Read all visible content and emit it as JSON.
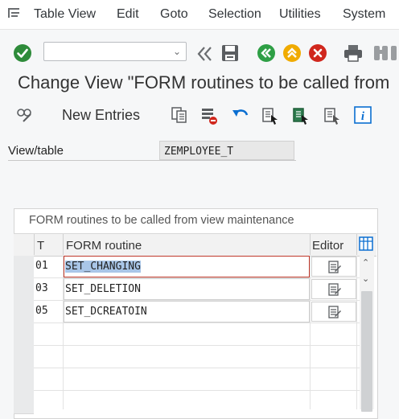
{
  "menu": {
    "items": [
      "Table View",
      "Edit",
      "Goto",
      "Selection",
      "Utilities",
      "System"
    ]
  },
  "toolbar": {
    "command_field_value": "",
    "icons": [
      "confirm-icon",
      "back-double-icon",
      "save-icon",
      "back-icon",
      "exit-icon",
      "cancel-icon",
      "print-icon",
      "find-icon"
    ]
  },
  "title": "Change View \"FORM routines to be called from",
  "app_toolbar": {
    "new_entries_label": "New Entries"
  },
  "view_table": {
    "label": "View/table",
    "value": "ZEMPLOYEE_T"
  },
  "panel": {
    "title": "FORM routines to be called from view maintenance",
    "columns": {
      "t": "T",
      "form_routine": "FORM routine",
      "editor": "Editor"
    },
    "rows": [
      {
        "t": "01",
        "form_routine": "SET_CHANGING"
      },
      {
        "t": "03",
        "form_routine": "SET_DELETION"
      },
      {
        "t": "05",
        "form_routine": "SET_DCREATOIN"
      }
    ]
  },
  "colors": {
    "confirm_green": "#2e8b3a",
    "nav_green": "#2e9f45",
    "nav_orange": "#f0ab00",
    "cancel_red": "#d0271d",
    "link_blue": "#0a6ed1"
  }
}
